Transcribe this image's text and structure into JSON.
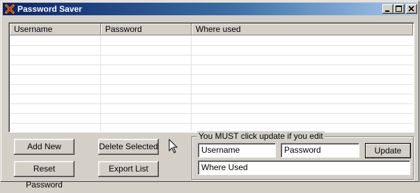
{
  "window": {
    "title": "Password Saver"
  },
  "titlebar": {
    "icons": [
      "app-icon",
      "minimize-icon",
      "maximize-icon",
      "close-icon"
    ]
  },
  "table": {
    "columns": [
      "Username",
      "Password",
      "Where used"
    ],
    "rows": []
  },
  "buttons": {
    "add_new": "Add New",
    "delete_selected": "Delete Selected",
    "reset_password": "Reset Password",
    "export_list": "Export List",
    "update": "Update"
  },
  "edit_group": {
    "label": "You MUST click update if you edit",
    "username": "Username",
    "password": "Password",
    "where_used": "Where Used"
  }
}
